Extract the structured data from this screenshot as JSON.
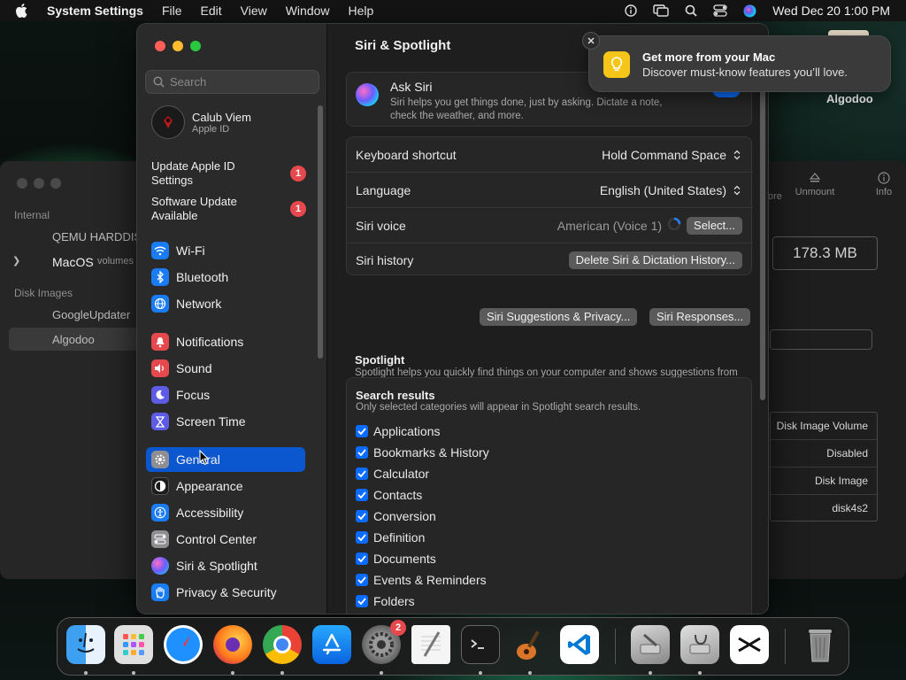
{
  "menubar": {
    "app_name": "System Settings",
    "menus": [
      "File",
      "Edit",
      "View",
      "Window",
      "Help"
    ],
    "clock": "Wed Dec 20  1:00 PM"
  },
  "background_window": {
    "sections": [
      "Internal",
      "Disk Images"
    ],
    "items": [
      "QEMU HARDDISK",
      "MacOS",
      "volumes",
      "GoogleUpdater",
      "Algodoo"
    ],
    "toolbar": [
      "Unmount",
      "Info"
    ],
    "partial_toolbar": "ore",
    "size": "178.3 MB",
    "info_rows": [
      "Disk Image Volume",
      "Disabled",
      "Disk Image",
      "disk4s2"
    ],
    "desktop_icon_label": "Algodoo"
  },
  "sidebar": {
    "search_placeholder": "Search",
    "account": {
      "name": "Calub Viem",
      "subtitle": "Apple ID"
    },
    "updates": [
      {
        "label": "Update Apple ID Settings",
        "badge": "1"
      },
      {
        "label": "Software Update Available",
        "badge": "1"
      }
    ],
    "items": [
      {
        "label": "Wi-Fi",
        "icon": "wifi-icon",
        "color": "#1a7cf5"
      },
      {
        "label": "Bluetooth",
        "icon": "bluetooth-icon",
        "color": "#1a7cf5"
      },
      {
        "label": "Network",
        "icon": "globe-icon",
        "color": "#1a7cf5"
      },
      {
        "label": "Notifications",
        "icon": "bell-icon",
        "color": "#e5484d"
      },
      {
        "label": "Sound",
        "icon": "speaker-icon",
        "color": "#e5484d"
      },
      {
        "label": "Focus",
        "icon": "moon-icon",
        "color": "#5e5ce6"
      },
      {
        "label": "Screen Time",
        "icon": "hourglass-icon",
        "color": "#5e5ce6"
      },
      {
        "label": "General",
        "icon": "gear-icon",
        "color": "#8e8e93",
        "selected": true
      },
      {
        "label": "Appearance",
        "icon": "appearance-icon",
        "color": "#1c1c1e"
      },
      {
        "label": "Accessibility",
        "icon": "accessibility-icon",
        "color": "#1a7cf5"
      },
      {
        "label": "Control Center",
        "icon": "control-center-icon",
        "color": "#8e8e93"
      },
      {
        "label": "Siri & Spotlight",
        "icon": "siri-icon",
        "color": "#6a5cff"
      },
      {
        "label": "Privacy & Security",
        "icon": "hand-icon",
        "color": "#1a7cf5"
      }
    ]
  },
  "content": {
    "title": "Siri & Spotlight",
    "ask_siri": {
      "title": "Ask Siri",
      "description": "Siri helps you get things done, just by asking. Dictate a note, check the weather, and more."
    },
    "settings": {
      "keyboard_shortcut": {
        "label": "Keyboard shortcut",
        "value": "Hold Command Space"
      },
      "language": {
        "label": "Language",
        "value": "English (United States)"
      },
      "siri_voice": {
        "label": "Siri voice",
        "value": "American (Voice 1)",
        "button": "Select..."
      },
      "siri_history": {
        "label": "Siri history",
        "button": "Delete Siri & Dictation History..."
      }
    },
    "buttons": {
      "suggestions": "Siri Suggestions & Privacy...",
      "responses": "Siri Responses..."
    },
    "spotlight": {
      "title": "Spotlight",
      "description": "Spotlight helps you quickly find things on your computer and shows suggestions from the Internet, Music, App Store, movie showtimes, locations nearby, and more."
    },
    "search_results": {
      "title": "Search results",
      "description": "Only selected categories will appear in Spotlight search results.",
      "items": [
        "Applications",
        "Bookmarks & History",
        "Calculator",
        "Contacts",
        "Conversion",
        "Definition",
        "Documents",
        "Events & Reminders",
        "Folders"
      ]
    }
  },
  "notification": {
    "title": "Get more from your Mac",
    "body": "Discover must-know features you’ll love."
  },
  "dock": {
    "apps": [
      "Finder",
      "Launchpad",
      "Safari",
      "Firefox",
      "Chrome",
      "App Store",
      "System Settings",
      "TextEdit",
      "Terminal",
      "GarageBand",
      "Visual Studio Code",
      "Disk Utility",
      "Disk Utility (alt)",
      "CapCut",
      "Trash"
    ],
    "settings_badge": "2"
  }
}
